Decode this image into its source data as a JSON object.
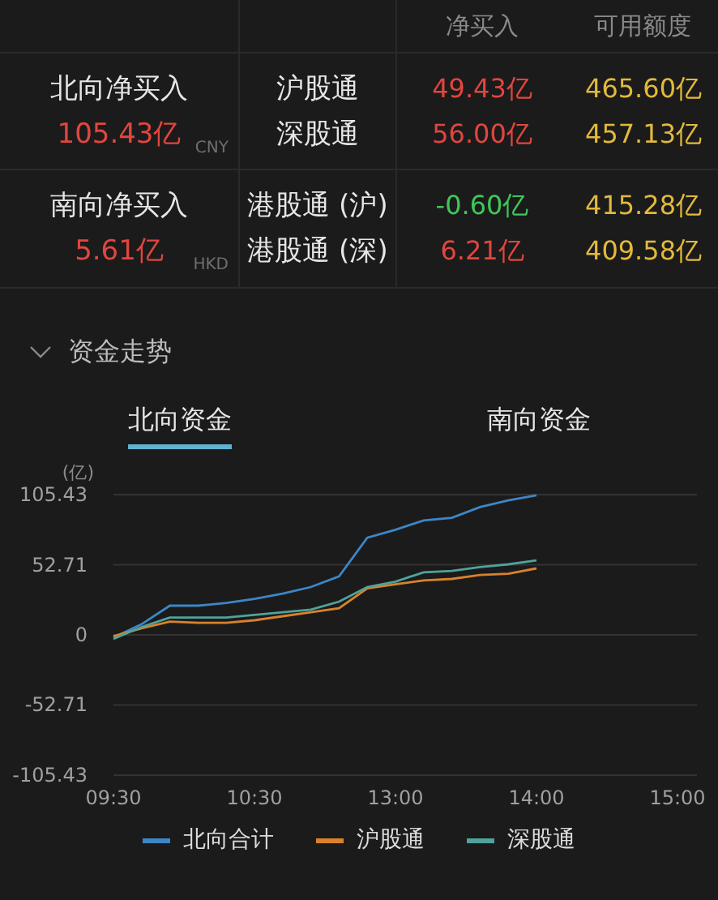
{
  "table": {
    "columns": [
      "净买入",
      "可用额度"
    ],
    "groups": [
      {
        "label": "北向净买入",
        "total": {
          "text": "105.43亿",
          "color": "#e0463f"
        },
        "currency": "CNY",
        "rows": [
          {
            "name": "沪股通",
            "net": "49.43亿",
            "color": "#e0463f",
            "quota": "465.60亿"
          },
          {
            "name": "深股通",
            "net": "56.00亿",
            "color": "#e0463f",
            "quota": "457.13亿"
          }
        ]
      },
      {
        "label": "南向净买入",
        "total": {
          "text": "5.61亿",
          "color": "#e0463f"
        },
        "currency": "HKD",
        "rows": [
          {
            "name": "港股通 (沪)",
            "net": "-0.60亿",
            "color": "#3fc75a",
            "quota": "415.28亿"
          },
          {
            "name": "港股通 (深)",
            "net": "6.21亿",
            "color": "#e0463f",
            "quota": "409.58亿"
          }
        ]
      }
    ]
  },
  "section": {
    "title": "资金走势",
    "expanded": true
  },
  "tabs": [
    {
      "label": "北向资金",
      "selected": true
    },
    {
      "label": "南向资金",
      "selected": false
    }
  ],
  "chart_data": {
    "type": "line",
    "ylabel": "(亿)",
    "categories": [
      "09:30",
      null,
      null,
      null,
      null,
      "10:30",
      null,
      null,
      null,
      null,
      "13:00",
      null,
      null,
      null,
      null,
      "14:00",
      null,
      null,
      null,
      null,
      "15:00"
    ],
    "series": [
      {
        "name": "北向合计",
        "color": "#3d86c6",
        "values": [
          -2,
          8,
          22,
          22,
          24,
          27,
          31,
          36,
          44,
          73,
          79,
          86,
          88,
          96,
          101,
          105,
          null,
          null,
          null,
          null,
          null
        ]
      },
      {
        "name": "沪股通",
        "color": "#d9822b",
        "values": [
          -1,
          5,
          10,
          9,
          9,
          11,
          14,
          17,
          20,
          35,
          38,
          41,
          42,
          45,
          46,
          50,
          null,
          null,
          null,
          null,
          null
        ]
      },
      {
        "name": "深股通",
        "color": "#4fa39b",
        "values": [
          -3,
          6,
          13,
          13,
          13,
          15,
          17,
          19,
          25,
          36,
          40,
          47,
          48,
          51,
          53,
          56,
          null,
          null,
          null,
          null,
          null
        ]
      }
    ],
    "ylim": [
      -105.43,
      105.43
    ],
    "grid": true,
    "yticks": [
      105.43,
      52.71,
      0,
      -52.71,
      -105.43
    ]
  }
}
